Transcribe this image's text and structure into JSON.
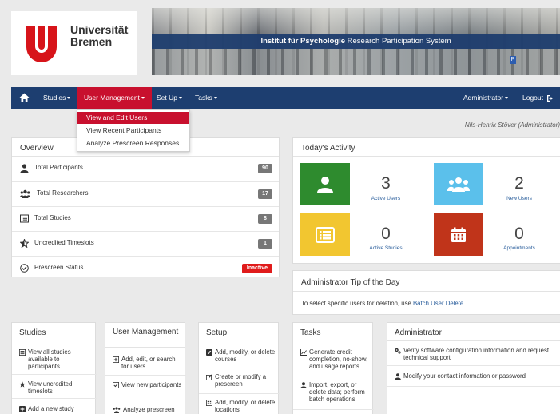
{
  "brand": {
    "line1": "Universität",
    "line2": "Bremen"
  },
  "banner": {
    "bold": "Institut für Psychologie",
    "rest": " Research Participation System"
  },
  "navbar": {
    "studies": "Studies",
    "user_management": "User Management",
    "setup": "Set Up",
    "tasks": "Tasks",
    "administrator": "Administrator",
    "logout": "Logout"
  },
  "dropdown": {
    "items": [
      "View and Edit Users",
      "View Recent Participants",
      "Analyze Prescreen Responses"
    ]
  },
  "user_line": "Nils-Henrik Stöver (Administrator)",
  "overview": {
    "title": "Overview",
    "rows": [
      {
        "label": "Total Participants",
        "value": "90"
      },
      {
        "label": "Total Researchers",
        "value": "17"
      },
      {
        "label": "Total Studies",
        "value": "8"
      },
      {
        "label": "Uncredited Timeslots",
        "value": "1"
      },
      {
        "label": "Prescreen Status",
        "value": "Inactive"
      }
    ]
  },
  "activity": {
    "title": "Today's Activity",
    "stats": [
      {
        "value": "3",
        "label": "Active Users",
        "color": "#2e8b2e"
      },
      {
        "value": "2",
        "label": "New Users",
        "color": "#5bc0eb"
      },
      {
        "value": "0",
        "label": "Active Studies",
        "color": "#f2c630"
      },
      {
        "value": "0",
        "label": "Appointments",
        "color": "#c0341a"
      }
    ]
  },
  "tip": {
    "title": "Administrator Tip of the Day",
    "text": "To select specific users for deletion, use ",
    "link": "Batch User Delete"
  },
  "studies_box": {
    "title": "Studies",
    "items": [
      "View all studies available to participants",
      "View uncredited timeslots",
      "Add a new study"
    ]
  },
  "usermgmt_box": {
    "title": "User Management",
    "items": [
      "Add, edit, or search for users",
      "View new participants",
      "Analyze prescreen"
    ]
  },
  "setup_box": {
    "title": "Setup",
    "items": [
      "Add, modify, or delete courses",
      "Create or modify a prescreen",
      "Add, modify, or delete locations"
    ]
  },
  "tasks_box": {
    "title": "Tasks",
    "items": [
      "Generate credit completion, no-show, and usage reports",
      "Import, export, or delete data; perform batch operations"
    ]
  },
  "admin_box": {
    "title": "Administrator",
    "items": [
      "Verify software configuration information and request technical support",
      "Modify your contact information or password"
    ]
  }
}
